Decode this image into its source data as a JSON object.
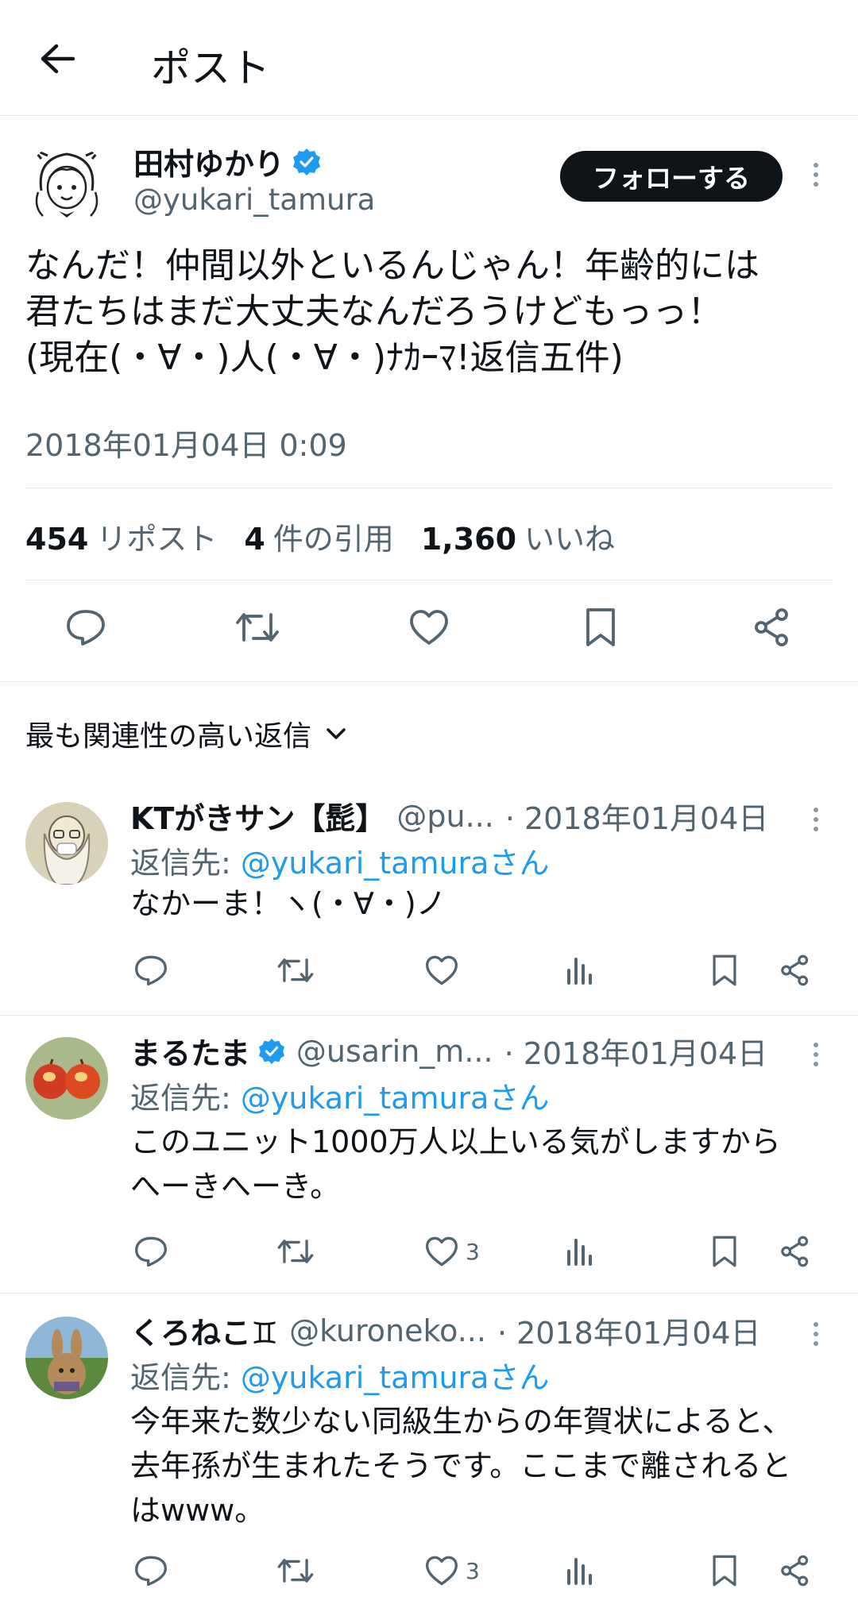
{
  "header": {
    "title": "ポスト"
  },
  "post": {
    "author_name": "田村ゆかり",
    "author_handle": "@yukari_tamura",
    "follow_label": "フォローする",
    "text": "なんだ！仲間以外といるんじゃん！年齢的には\n君たちはまだ大丈夫なんだろうけどもっっ！\n(現在(・∀・)人(・∀・)ﾅｶｰﾏ!返信五件)",
    "timestamp": "2018年01月04日 0:09",
    "stats": {
      "reposts_count": "454",
      "reposts_label": "リポスト",
      "quotes_count": "4",
      "quotes_label": "件の引用",
      "likes_count": "1,360",
      "likes_label": "いいね"
    }
  },
  "sort": {
    "label": "最も関連性の高い返信"
  },
  "replies": [
    {
      "name": "KTがきサン【髭】",
      "handle": "@pu...",
      "date": "· 2018年01月04日",
      "reply_prefix": "返信先: ",
      "reply_to": "@yukari_tamuraさん",
      "text": "なかーま！ヽ(・∀・)ノ",
      "like_count": ""
    },
    {
      "name": "まるたま",
      "handle": "@usarin_m...",
      "date": "· 2018年01月04日",
      "reply_prefix": "返信先: ",
      "reply_to": "@yukari_tamuraさん",
      "text": "このユニット1000万人以上いる気がしますから\nへーきへーき。",
      "like_count": "3"
    },
    {
      "name": "くろねこ♊",
      "handle": "@kuroneko...",
      "date": "· 2018年01月04日",
      "reply_prefix": "返信先: ",
      "reply_to": "@yukari_tamuraさん",
      "text": "今年来た数少ない同級生からの年賀状によると、\n去年孫が生まれたそうです。ここまで離されると\nはwww。",
      "like_count": "3"
    }
  ],
  "colors": {
    "accent": "#1d9bf0",
    "secondary_text": "#536471",
    "primary_text": "#0f1419"
  }
}
